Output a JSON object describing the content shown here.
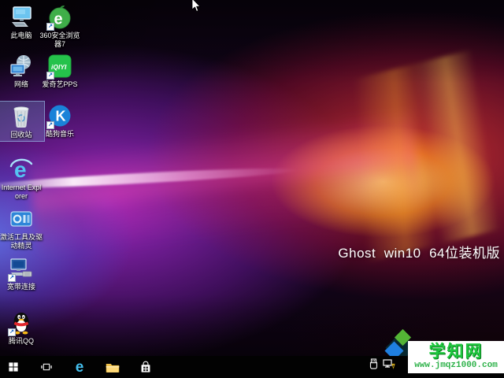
{
  "desktop": {
    "headline": "Ghost  win10  64位装机版",
    "icons": [
      {
        "id": "this-pc",
        "label": "此电脑",
        "selected": false
      },
      {
        "id": "360-browser",
        "label": "360安全浏览器7",
        "selected": false,
        "shortcut": true
      },
      {
        "id": "network",
        "label": "网络",
        "selected": false
      },
      {
        "id": "iqiyi-pps",
        "label": "爱奇艺PPS",
        "selected": false,
        "shortcut": true
      },
      {
        "id": "recycle-bin",
        "label": "回收站",
        "selected": true
      },
      {
        "id": "kugou-music",
        "label": "酷狗音乐",
        "selected": false,
        "shortcut": true
      },
      {
        "id": "internet-explorer",
        "label": "Internet Explorer",
        "selected": false
      },
      {
        "id": "activation-tools",
        "label": "激活工具及驱动精灵",
        "selected": false
      },
      {
        "id": "broadband",
        "label": "宽带连接",
        "selected": false,
        "shortcut": true
      },
      {
        "id": "tencent-qq",
        "label": "腾讯QQ",
        "selected": false,
        "shortcut": true
      }
    ]
  },
  "taskbar": {
    "bg_color": "#020202",
    "buttons": [
      "start",
      "task-view",
      "edge",
      "file-explorer",
      "store"
    ],
    "tray_icons": [
      "usb-device",
      "network-warning"
    ]
  },
  "watermark": {
    "title": "学知网",
    "url": "www.jmqz1000.com",
    "title_color": "#1fc83f",
    "url_color": "#2eb24a",
    "box_bg": "#ffffff",
    "logo_colors": {
      "green": "#54b435",
      "blue": "#1f7fe0",
      "dark": "#082830"
    }
  },
  "iqiyi_logo_text": "iQIYI",
  "kugou_letter": "K",
  "browser_letter": "e",
  "shortcut_arrow": "↗"
}
